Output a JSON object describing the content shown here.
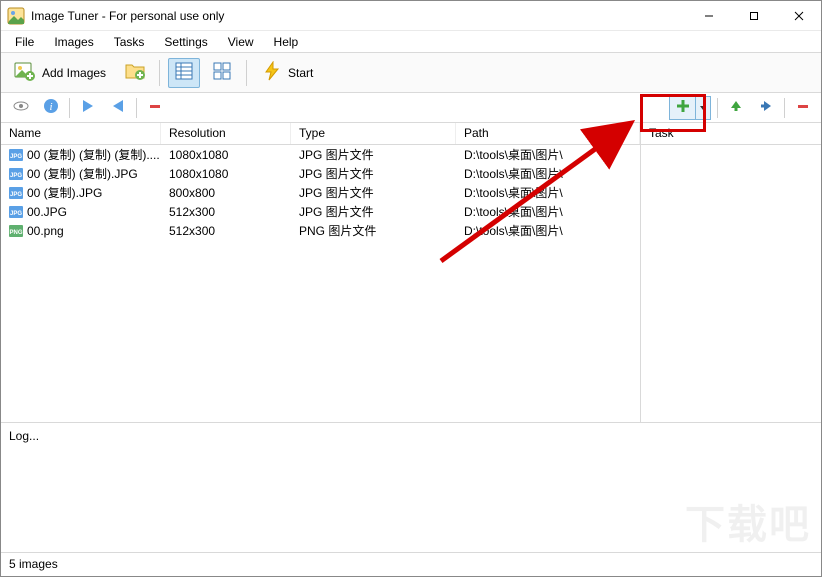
{
  "window": {
    "title": "Image Tuner - For personal use only"
  },
  "menu": {
    "file": "File",
    "images": "Images",
    "tasks": "Tasks",
    "settings": "Settings",
    "view": "View",
    "help": "Help"
  },
  "toolbar": {
    "add_images": "Add Images",
    "start": "Start"
  },
  "columns": {
    "name": "Name",
    "resolution": "Resolution",
    "type": "Type",
    "path": "Path",
    "task": "Task"
  },
  "files": [
    {
      "name": "00 (复制) (复制) (复制)....",
      "resolution": "1080x1080",
      "type": "JPG 图片文件",
      "path": "D:\\tools\\桌面\\图片\\",
      "format": "jpg"
    },
    {
      "name": "00 (复制) (复制).JPG",
      "resolution": "1080x1080",
      "type": "JPG 图片文件",
      "path": "D:\\tools\\桌面\\图片\\",
      "format": "jpg"
    },
    {
      "name": "00 (复制).JPG",
      "resolution": "800x800",
      "type": "JPG 图片文件",
      "path": "D:\\tools\\桌面\\图片\\",
      "format": "jpg"
    },
    {
      "name": "00.JPG",
      "resolution": "512x300",
      "type": "JPG 图片文件",
      "path": "D:\\tools\\桌面\\图片\\",
      "format": "jpg"
    },
    {
      "name": "00.png",
      "resolution": "512x300",
      "type": "PNG 图片文件",
      "path": "D:\\tools\\桌面\\图片\\",
      "format": "png"
    }
  ],
  "log": {
    "label": "Log..."
  },
  "status": {
    "text": "5 images"
  },
  "watermark": "下载吧"
}
